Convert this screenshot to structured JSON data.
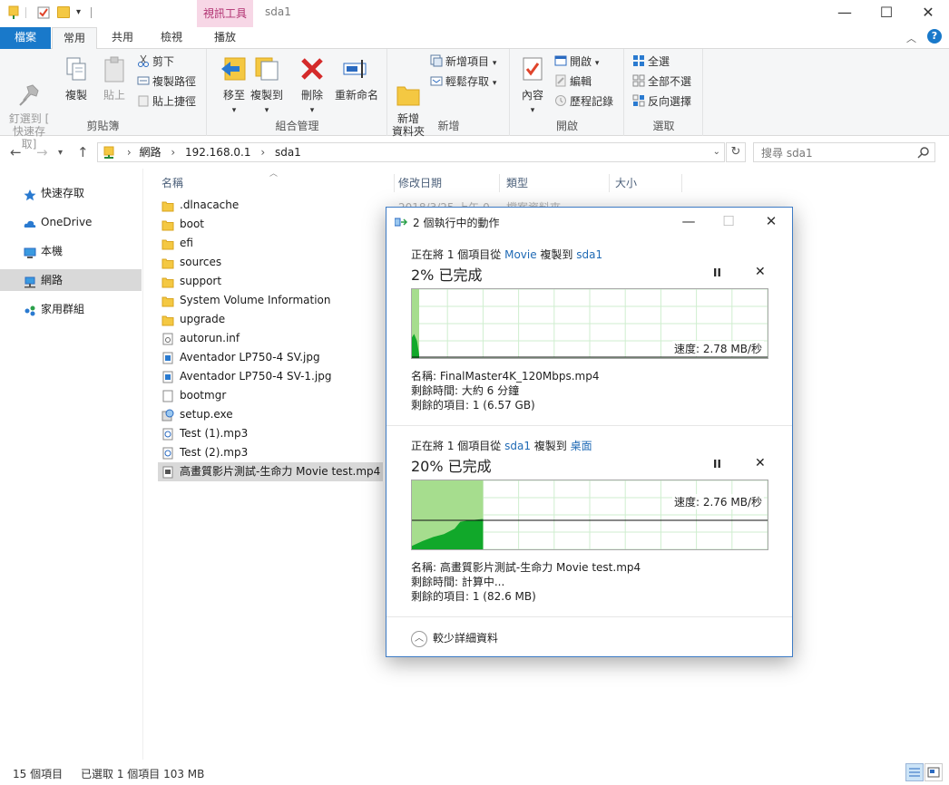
{
  "window": {
    "context_tab": "視訊工具",
    "title": "sda1",
    "min": "—",
    "max": "☐",
    "close": "✕"
  },
  "ribbon": {
    "tabs": [
      "檔案",
      "常用",
      "共用",
      "檢視",
      "播放"
    ],
    "active_tab": "常用",
    "clipboard": {
      "pin": "釘選到 [\n快速存取]",
      "copy": "複製",
      "paste": "貼上",
      "cut": "剪下",
      "copy_path": "複製路徑",
      "paste_shortcut": "貼上捷徑",
      "label": "剪貼簿"
    },
    "organize": {
      "move_to": "移至",
      "copy_to": "複製到",
      "delete": "刪除",
      "rename": "重新命名",
      "label": "組合管理"
    },
    "new": {
      "new_folder": "新增\n資料夾",
      "new_item": "新增項目",
      "easy_access": "輕鬆存取",
      "label": "新增"
    },
    "open": {
      "properties": "內容",
      "open": "開啟",
      "edit": "編輯",
      "history": "歷程記錄",
      "label": "開啟"
    },
    "select": {
      "select_all": "全選",
      "select_none": "全部不選",
      "invert": "反向選擇",
      "label": "選取"
    }
  },
  "address": {
    "segments": [
      "網路",
      "192.168.0.1",
      "sda1"
    ],
    "search_placeholder": "搜尋 sda1"
  },
  "navpane": {
    "items": [
      {
        "label": "快速存取",
        "icon": "star-icon"
      },
      {
        "label": "OneDrive",
        "icon": "cloud-icon"
      },
      {
        "label": "本機",
        "icon": "computer-icon"
      },
      {
        "label": "網路",
        "icon": "network-icon",
        "selected": true
      },
      {
        "label": "家用群組",
        "icon": "homegroup-icon"
      }
    ]
  },
  "filelist": {
    "columns": [
      "名稱",
      "修改日期",
      "類型",
      "大小"
    ],
    "first_row_date": "2018/3/25 上午 0...",
    "first_row_type": "檔案資料夾",
    "files": [
      {
        "name": ".dlnacache",
        "icon": "folder-icon"
      },
      {
        "name": "boot",
        "icon": "folder-icon"
      },
      {
        "name": "efi",
        "icon": "folder-icon"
      },
      {
        "name": "sources",
        "icon": "folder-icon"
      },
      {
        "name": "support",
        "icon": "folder-icon"
      },
      {
        "name": "System Volume Information",
        "icon": "folder-icon"
      },
      {
        "name": "upgrade",
        "icon": "folder-icon"
      },
      {
        "name": "autorun.inf",
        "icon": "settings-file-icon"
      },
      {
        "name": "Aventador LP750-4 SV.jpg",
        "icon": "image-file-icon"
      },
      {
        "name": "Aventador LP750-4 SV-1.jpg",
        "icon": "image-file-icon"
      },
      {
        "name": "bootmgr",
        "icon": "blank-file-icon"
      },
      {
        "name": "setup.exe",
        "icon": "setup-icon"
      },
      {
        "name": "Test (1).mp3",
        "icon": "audio-file-icon"
      },
      {
        "name": "Test (2).mp3",
        "icon": "audio-file-icon"
      },
      {
        "name": "高畫質影片測試-生命力 Movie test.mp4",
        "icon": "video-file-icon",
        "selected": true
      }
    ]
  },
  "status": {
    "count": "15 個項目",
    "selected": "已選取 1 個項目  103 MB"
  },
  "dialog": {
    "title": "2 個執行中的動作",
    "ops": [
      {
        "header_pre": "正在將 1 個項目從 ",
        "src": "Movie",
        "header_mid": " 複製到 ",
        "dst": "sda1",
        "percent_text": "2% 已完成",
        "percent": 0.02,
        "speed": "速度: 2.78 MB/秒",
        "name": "名稱:  FinalMaster4K_120Mbps.mp4",
        "remaining_time": "剩餘時間:  大約 6 分鐘",
        "remaining_items": "剩餘的項目:  1 (6.57 GB)"
      },
      {
        "header_pre": "正在將 1 個項目從 ",
        "src": "sda1",
        "header_mid": " 複製到 ",
        "dst": "桌面",
        "percent_text": "20% 已完成",
        "percent": 0.2,
        "speed": "速度: 2.76 MB/秒",
        "name": "名稱:  高畫質影片測試-生命力 Movie test.mp4",
        "remaining_time": "剩餘時間:  計算中...",
        "remaining_items": "剩餘的項目:  1 (82.6 MB)"
      }
    ],
    "pause": "II",
    "cancel": "✕",
    "fewer_details": "較少詳細資料"
  }
}
